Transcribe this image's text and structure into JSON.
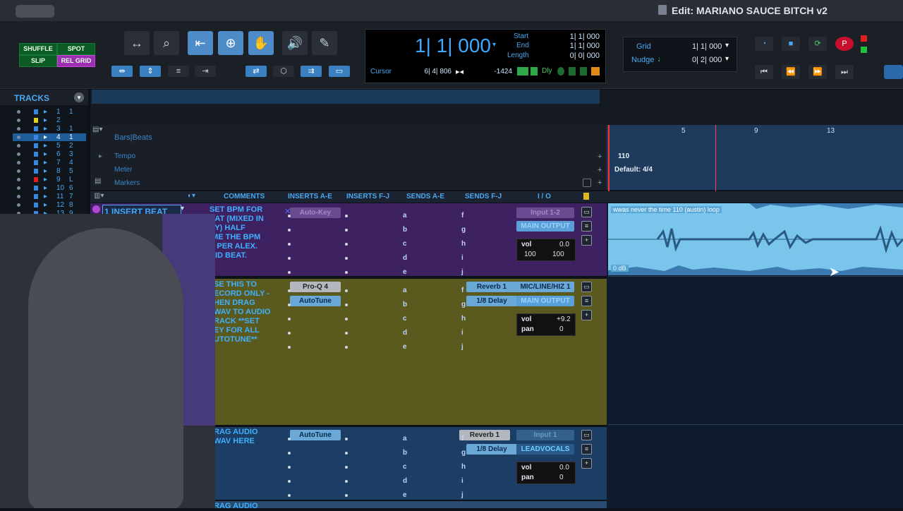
{
  "window": {
    "title": "Edit: MARIANO SAUCE BITCH v2"
  },
  "modes": {
    "shuffle": "SHUFFLE",
    "spot": "SPOT",
    "slip": "SLIP",
    "rel_grid": "REL GRID"
  },
  "counter": {
    "main": "1| 1| 000",
    "start_label": "Start",
    "start": "1| 1| 000",
    "end_label": "End",
    "end": "1| 1| 000",
    "length_label": "Length",
    "length": "0| 0| 000",
    "cursor_label": "Cursor",
    "cursor": "6| 4| 806",
    "offset": "-1424",
    "dly": "Dly"
  },
  "grid": {
    "grid_label": "Grid",
    "grid_value": "1| 1| 000",
    "nudge_label": "Nudge",
    "nudge_value": "0| 2| 000"
  },
  "tracks_panel": {
    "title": "TRACKS",
    "items": [
      {
        "name": "1",
        "num": "1"
      },
      {
        "name": "2",
        "num": ""
      },
      {
        "name": "3",
        "num": "1"
      },
      {
        "name": "4",
        "num": "1"
      },
      {
        "name": "5",
        "num": "2"
      },
      {
        "name": "6",
        "num": "3"
      },
      {
        "name": "7",
        "num": "4"
      },
      {
        "name": "8",
        "num": "5"
      },
      {
        "name": "9",
        "num": "L"
      },
      {
        "name": "10",
        "num": "6"
      },
      {
        "name": "11",
        "num": "7"
      },
      {
        "name": "12",
        "num": "8"
      },
      {
        "name": "13",
        "num": "9"
      }
    ]
  },
  "rulers": {
    "bars_beats": "Bars|Beats",
    "tempo": "Tempo",
    "meter": "Meter",
    "markers": "Markers",
    "tempo_value": "110",
    "meter_value": "Default: 4/4",
    "bar_marks": [
      "5",
      "9",
      "13"
    ]
  },
  "columns": {
    "comments": "COMMENTS",
    "inserts_ae": "INSERTS A-E",
    "inserts_fj": "INSERTS F-J",
    "sends_ae": "SENDS A-E",
    "sends_fj": "SENDS F-J",
    "io": "I / O"
  },
  "tracks": [
    {
      "name": "1 INSERT BEAT",
      "comment": "SET BPM FOR\nEAT (MIXED IN\nEY) HALF\nIME THE BPM\nS PER ALEX.\nRID BEAT.",
      "insert1": "Auto-Key",
      "input": "Input 1-2",
      "output": "MAIN OUTPUT",
      "vol_label": "vol",
      "vol": "0.0",
      "pan_l": "100",
      "pan_r": "100"
    },
    {
      "comment": "SE THIS TO\nECORD ONLY -\nHEN DRAG\nWAV TO AUDIO\nRACK **SET\nEY FOR ALL\nUTOTUNE**",
      "insert1": "Pro-Q 4",
      "insert2": "AutoTune",
      "send_f": "Reverb 1",
      "send_g": "1/8 Delay",
      "input": "MIC/LINE/HIZ 1",
      "output": "MAIN OUTPUT",
      "vol_label": "vol",
      "vol": "+9.2",
      "pan_label": "pan",
      "pan": "0"
    },
    {
      "comment": "RAG AUDIO\nWAV HERE",
      "insert1": "AutoTune",
      "send_f": "Reverb 1",
      "send_g": "1/8 Delay",
      "input": "Input 1",
      "output": "LEADVOCALS",
      "vol_label": "vol",
      "vol": "0.0",
      "pan_label": "pan",
      "pan": "0"
    },
    {
      "comment": "RAG AUDIO"
    }
  ],
  "send_letters_ae": [
    "a",
    "b",
    "c",
    "d",
    "e"
  ],
  "send_letters_fj": [
    "f",
    "g",
    "h",
    "i",
    "j"
  ],
  "region": {
    "name": "wwas never the time 110 (austin) loop",
    "gain": "0 dB"
  }
}
